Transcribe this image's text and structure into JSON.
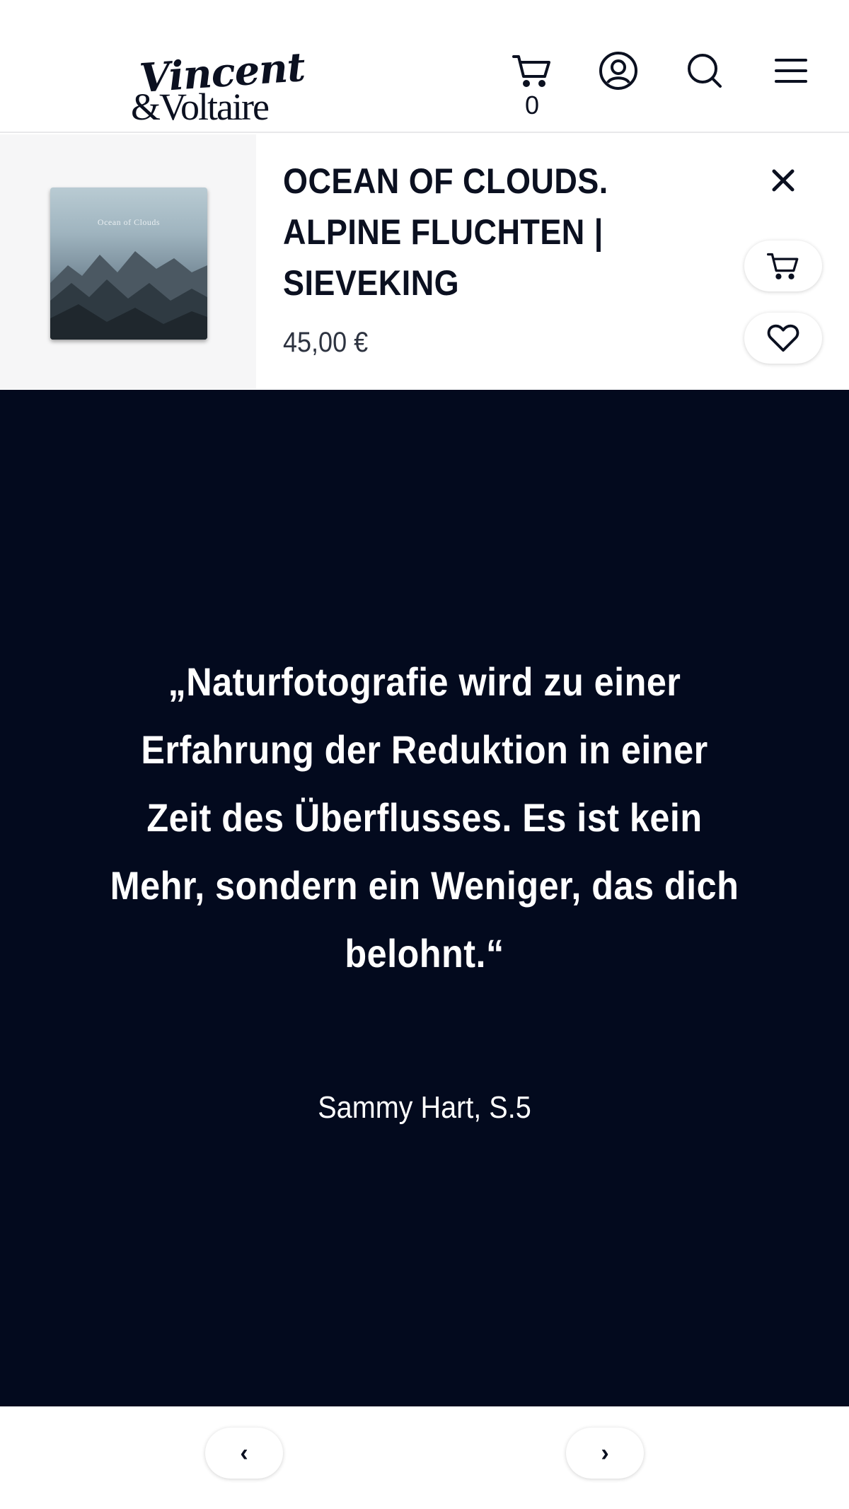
{
  "header": {
    "logo_line1": "Vincent",
    "logo_line2": "&Voltaire",
    "cart_count": "0"
  },
  "product": {
    "thumbnail_title": "Ocean of Clouds",
    "title": "OCEAN OF CLOUDS. ALPINE FLUCHTEN | SIEVEKING",
    "price": "45,00 €"
  },
  "quote": {
    "text": "„Naturfotografie wird zu einer Erfahrung der Reduktion in einer Zeit des Überflusses. Es ist kein Mehr, sondern ein Weniger, das dich belohnt.“",
    "author": "Sammy Hart, S.5"
  },
  "pager": {
    "prev": "‹",
    "next": "›"
  },
  "colors": {
    "quote_background": "#030a1e",
    "text_dark": "#0b1020"
  },
  "icons": [
    "cart-icon",
    "user-icon",
    "search-icon",
    "menu-icon",
    "close-icon",
    "heart-icon"
  ]
}
